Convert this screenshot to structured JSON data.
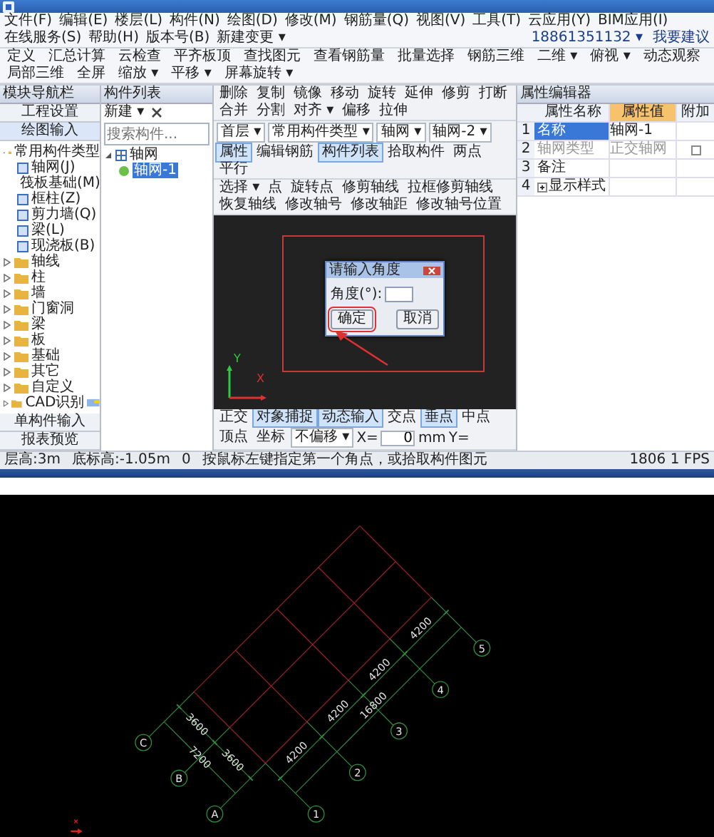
{
  "menu_bar": [
    "文件(F)",
    "编辑(E)",
    "楼层(L)",
    "构件(N)",
    "绘图(D)",
    "修改(M)",
    "钢筋量(Q)",
    "视图(V)",
    "工具(T)",
    "云应用(Y)",
    "BIM应用(I)",
    "在线服务(S)",
    "帮助(H)",
    "版本号(B)",
    "新建变更 ▾"
  ],
  "account": {
    "phone": "18861351132 ▾",
    "feedback": "我要建议"
  },
  "toolbar": [
    "定义",
    "汇总计算",
    "云检查",
    "平齐板顶",
    "查找图元",
    "查看钢筋量",
    "批量选择",
    "钢筋三维",
    "二维 ▾",
    "俯视 ▾",
    "动态观察",
    "局部三维",
    "全屏",
    "缩放 ▾",
    "平移 ▾",
    "屏幕旋转 ▾"
  ],
  "nav_panel": {
    "title": "模块导航栏",
    "tabs": [
      {
        "label": "工程设置",
        "selected": false
      },
      {
        "label": "绘图输入",
        "selected": true
      }
    ],
    "tree": [
      {
        "label": "常用构件类型",
        "expanded": true,
        "children": [
          {
            "label": "轴网(J)"
          },
          {
            "label": "筏板基础(M)"
          },
          {
            "label": "框柱(Z)"
          },
          {
            "label": "剪力墙(Q)"
          },
          {
            "label": "梁(L)"
          },
          {
            "label": "现浇板(B)"
          }
        ]
      },
      {
        "label": "轴线",
        "expanded": false
      },
      {
        "label": "柱",
        "expanded": false
      },
      {
        "label": "墙",
        "expanded": false
      },
      {
        "label": "门窗洞",
        "expanded": false
      },
      {
        "label": "梁",
        "expanded": false
      },
      {
        "label": "板",
        "expanded": false
      },
      {
        "label": "基础",
        "expanded": false
      },
      {
        "label": "其它",
        "expanded": false
      },
      {
        "label": "自定义",
        "expanded": false
      },
      {
        "label": "CAD识别",
        "expanded": false,
        "new_badge": true
      }
    ],
    "bottom_tabs": [
      "单构件输入",
      "报表预览"
    ]
  },
  "component_list": {
    "title": "构件列表",
    "new_button": "新建 ▾",
    "search": {
      "placeholder": "搜索构件..."
    },
    "tree": [
      {
        "label": "轴网",
        "expanded": true,
        "children": [
          {
            "label": "轴网-1",
            "selected": true
          }
        ]
      }
    ]
  },
  "edit_toolbar": [
    "删除",
    "复制",
    "镜像",
    "移动",
    "旋转",
    "延伸",
    "修剪",
    "打断",
    "合并",
    "分割",
    "对齐 ▾",
    "偏移",
    "拉伸"
  ],
  "layer_bar": {
    "selectors": [
      "首层 ▾",
      "常用构件类型 ▾",
      "轴网 ▾",
      "轴网-2 ▾"
    ],
    "buttons": [
      {
        "label": "属性",
        "selected": true
      },
      {
        "label": "编辑钢筋",
        "selected": false
      },
      {
        "label": "构件列表",
        "selected": true
      },
      {
        "label": "拾取构件",
        "selected": false
      },
      {
        "label": "两点",
        "selected": false
      },
      {
        "label": "平行",
        "selected": false
      }
    ]
  },
  "draw_toolbar": [
    "选择 ▾",
    "点",
    "旋转点",
    "修剪轴线",
    "拉框修剪轴线",
    "恢复轴线",
    "修改轴号",
    "修改轴距",
    "修改轴号位置"
  ],
  "canvas": {
    "axis_labels": [
      "X",
      "Y"
    ],
    "dialog": {
      "title": "请输入角度",
      "label": "角度(°):",
      "buttons": [
        {
          "label": "确定",
          "annotated": true
        },
        {
          "label": "取消",
          "annotated": false
        }
      ]
    }
  },
  "snap_bar": {
    "buttons": [
      {
        "label": "正交",
        "selected": false
      },
      {
        "label": "对象捕捉",
        "selected": true
      },
      {
        "label": "动态输入",
        "selected": true
      },
      {
        "label": "交点",
        "selected": false
      },
      {
        "label": "垂点",
        "selected": true
      },
      {
        "label": "中点",
        "selected": false
      },
      {
        "label": "顶点",
        "selected": false
      },
      {
        "label": "坐标",
        "selected": false
      }
    ],
    "offset": "不偏移 ▾",
    "x_label": "X=",
    "x_value": "0",
    "unit": "mm",
    "y_label": "Y="
  },
  "properties": {
    "title": "属性编辑器",
    "columns": [
      "属性名称",
      "属性值",
      "附加"
    ],
    "rows": [
      {
        "index": "1",
        "name": "名称",
        "value": "轴网-1",
        "selected": true,
        "disabled": false,
        "kind": "text"
      },
      {
        "index": "2",
        "name": "轴网类型",
        "value": "正交轴网",
        "selected": false,
        "disabled": true,
        "kind": "checkbox",
        "checked": false
      },
      {
        "index": "3",
        "name": "备注",
        "selected": false,
        "disabled": false,
        "kind": "text"
      },
      {
        "index": "4",
        "name": "显示样式",
        "selected": false,
        "disabled": false,
        "kind": "group",
        "expanded": false
      }
    ]
  },
  "status_bar": {
    "floor_height": "层高:3m",
    "base_elevation": "底标高:-1.05m",
    "value": "0",
    "hint": "按鼠标左键指定第一个角点，或拾取构件图元",
    "fps": "1806 1 FPS"
  },
  "cad": {
    "number_axes": [
      "1",
      "2",
      "3",
      "4",
      "5"
    ],
    "letter_axes": [
      "A",
      "B",
      "C"
    ],
    "number_spans": [
      "4200",
      "4200",
      "4200",
      "4200"
    ],
    "number_total": "16800",
    "letter_spans": [
      "3600",
      "3600"
    ],
    "letter_total": "7200"
  }
}
